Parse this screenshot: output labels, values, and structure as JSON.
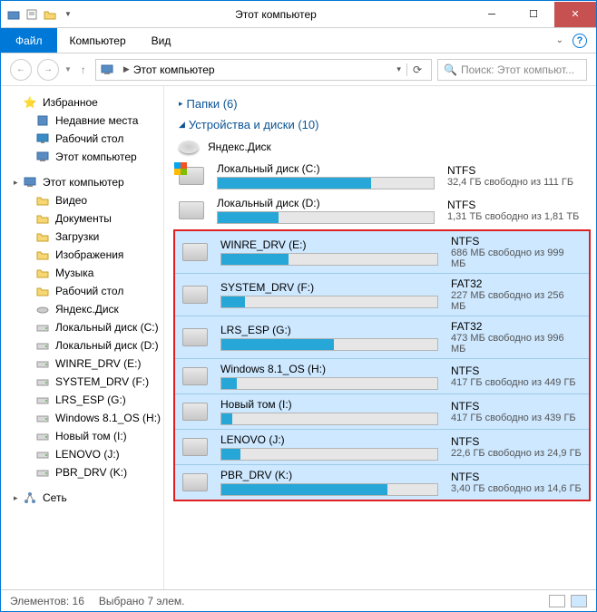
{
  "window": {
    "title": "Этот компьютер"
  },
  "ribbon": {
    "file": "Файл",
    "computer": "Компьютер",
    "view": "Вид"
  },
  "address": {
    "location": "Этот компьютер"
  },
  "search": {
    "placeholder": "Поиск: Этот компьют..."
  },
  "sidebar": {
    "favorites": {
      "label": "Избранное",
      "items": [
        {
          "label": "Недавние места",
          "icon": "recent"
        },
        {
          "label": "Рабочий стол",
          "icon": "desktop"
        },
        {
          "label": "Этот компьютер",
          "icon": "pc"
        }
      ]
    },
    "thispc": {
      "label": "Этот компьютер",
      "items": [
        {
          "label": "Видео",
          "icon": "folder"
        },
        {
          "label": "Документы",
          "icon": "folder"
        },
        {
          "label": "Загрузки",
          "icon": "folder"
        },
        {
          "label": "Изображения",
          "icon": "folder"
        },
        {
          "label": "Музыка",
          "icon": "folder"
        },
        {
          "label": "Рабочий стол",
          "icon": "folder"
        },
        {
          "label": "Яндекс.Диск",
          "icon": "yadisk"
        },
        {
          "label": "Локальный диск (C:)",
          "icon": "drive-os"
        },
        {
          "label": "Локальный диск (D:)",
          "icon": "drive"
        },
        {
          "label": "WINRE_DRV (E:)",
          "icon": "drive"
        },
        {
          "label": "SYSTEM_DRV (F:)",
          "icon": "drive"
        },
        {
          "label": "LRS_ESP (G:)",
          "icon": "drive"
        },
        {
          "label": "Windows 8.1_OS (H:)",
          "icon": "drive"
        },
        {
          "label": "Новый том (I:)",
          "icon": "drive"
        },
        {
          "label": "LENOVO (J:)",
          "icon": "drive"
        },
        {
          "label": "PBR_DRV (K:)",
          "icon": "drive"
        }
      ]
    },
    "network": {
      "label": "Сеть"
    }
  },
  "groups": {
    "folders": {
      "label": "Папки (6)"
    },
    "devices": {
      "label": "Устройства и диски (10)"
    }
  },
  "yandex": {
    "label": "Яндекс.Диск"
  },
  "drives": {
    "unselected": [
      {
        "name": "Локальный диск (C:)",
        "fs": "NTFS",
        "free": "32,4 ГБ свободно из 111 ГБ",
        "fill": 71,
        "os": true
      },
      {
        "name": "Локальный диск (D:)",
        "fs": "NTFS",
        "free": "1,31 ТБ свободно из 1,81 ТБ",
        "fill": 28
      }
    ],
    "selected": [
      {
        "name": "WINRE_DRV (E:)",
        "fs": "NTFS",
        "free": "686 МБ свободно из 999 МБ",
        "fill": 31
      },
      {
        "name": "SYSTEM_DRV (F:)",
        "fs": "FAT32",
        "free": "227 МБ свободно из 256 МБ",
        "fill": 11
      },
      {
        "name": "LRS_ESP (G:)",
        "fs": "FAT32",
        "free": "473 МБ свободно из 996 МБ",
        "fill": 52
      },
      {
        "name": "Windows 8.1_OS (H:)",
        "fs": "NTFS",
        "free": "417 ГБ свободно из 449 ГБ",
        "fill": 7
      },
      {
        "name": "Новый том (I:)",
        "fs": "NTFS",
        "free": "417 ГБ свободно из 439 ГБ",
        "fill": 5
      },
      {
        "name": "LENOVO (J:)",
        "fs": "NTFS",
        "free": "22,6 ГБ свободно из 24,9 ГБ",
        "fill": 9
      },
      {
        "name": "PBR_DRV (K:)",
        "fs": "NTFS",
        "free": "3,40 ГБ свободно из 14,6 ГБ",
        "fill": 77
      }
    ]
  },
  "status": {
    "items": "Элементов: 16",
    "selected": "Выбрано 7 элем."
  }
}
